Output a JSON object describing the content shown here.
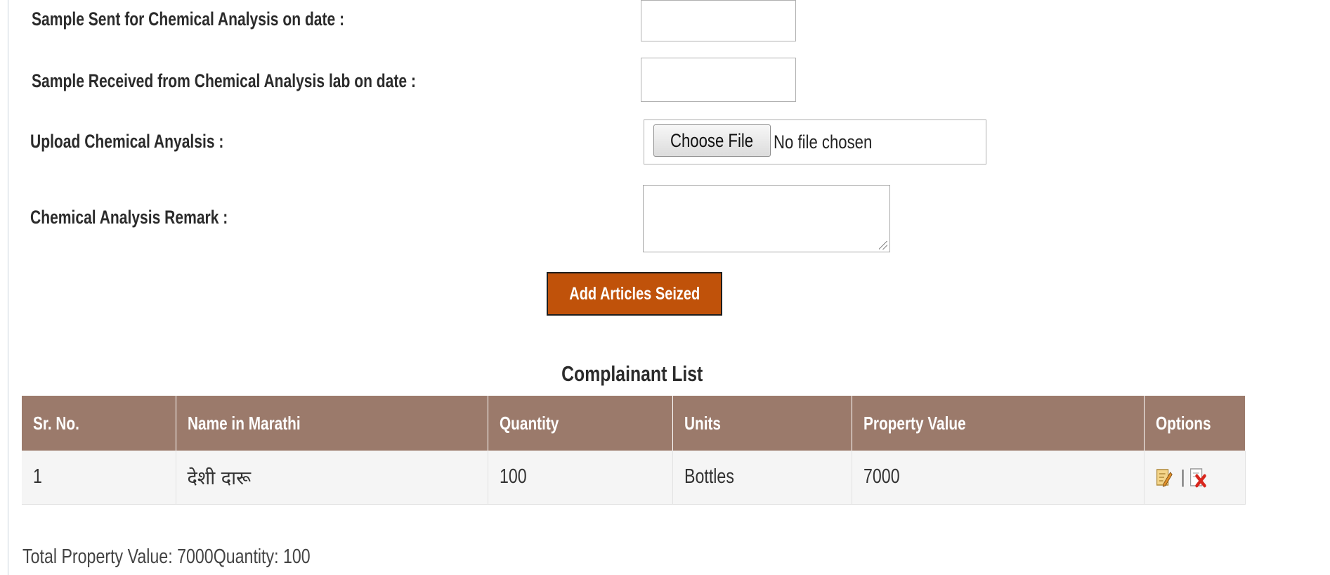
{
  "form": {
    "sample_sent_label": "Sample Sent for Chemical Analysis on date :",
    "sample_received_label": "Sample Received from Chemical Analysis lab on date :",
    "upload_label": "Upload Chemical Anyalsis :",
    "choose_file_label": "Choose File",
    "no_file_text": "No file chosen",
    "remark_label": "Chemical Analysis Remark :",
    "add_button_label": "Add Articles Seized"
  },
  "list": {
    "title": "Complainant List",
    "columns": [
      "Sr. No.",
      "Name in Marathi",
      "Quantity",
      "Units",
      "Property Value",
      "Options"
    ],
    "rows": [
      [
        "1",
        "देशी दारू",
        "100",
        "Bottles",
        "7000"
      ]
    ],
    "option_icons": [
      "edit-icon",
      "delete-icon"
    ]
  },
  "summary": {
    "total_text": "Total Property Value: 7000Quantity: 100"
  },
  "colors": {
    "header_bg": "#9b7a6b",
    "button_bg": "#c0520a",
    "row_bg": "#f5f5f5"
  }
}
